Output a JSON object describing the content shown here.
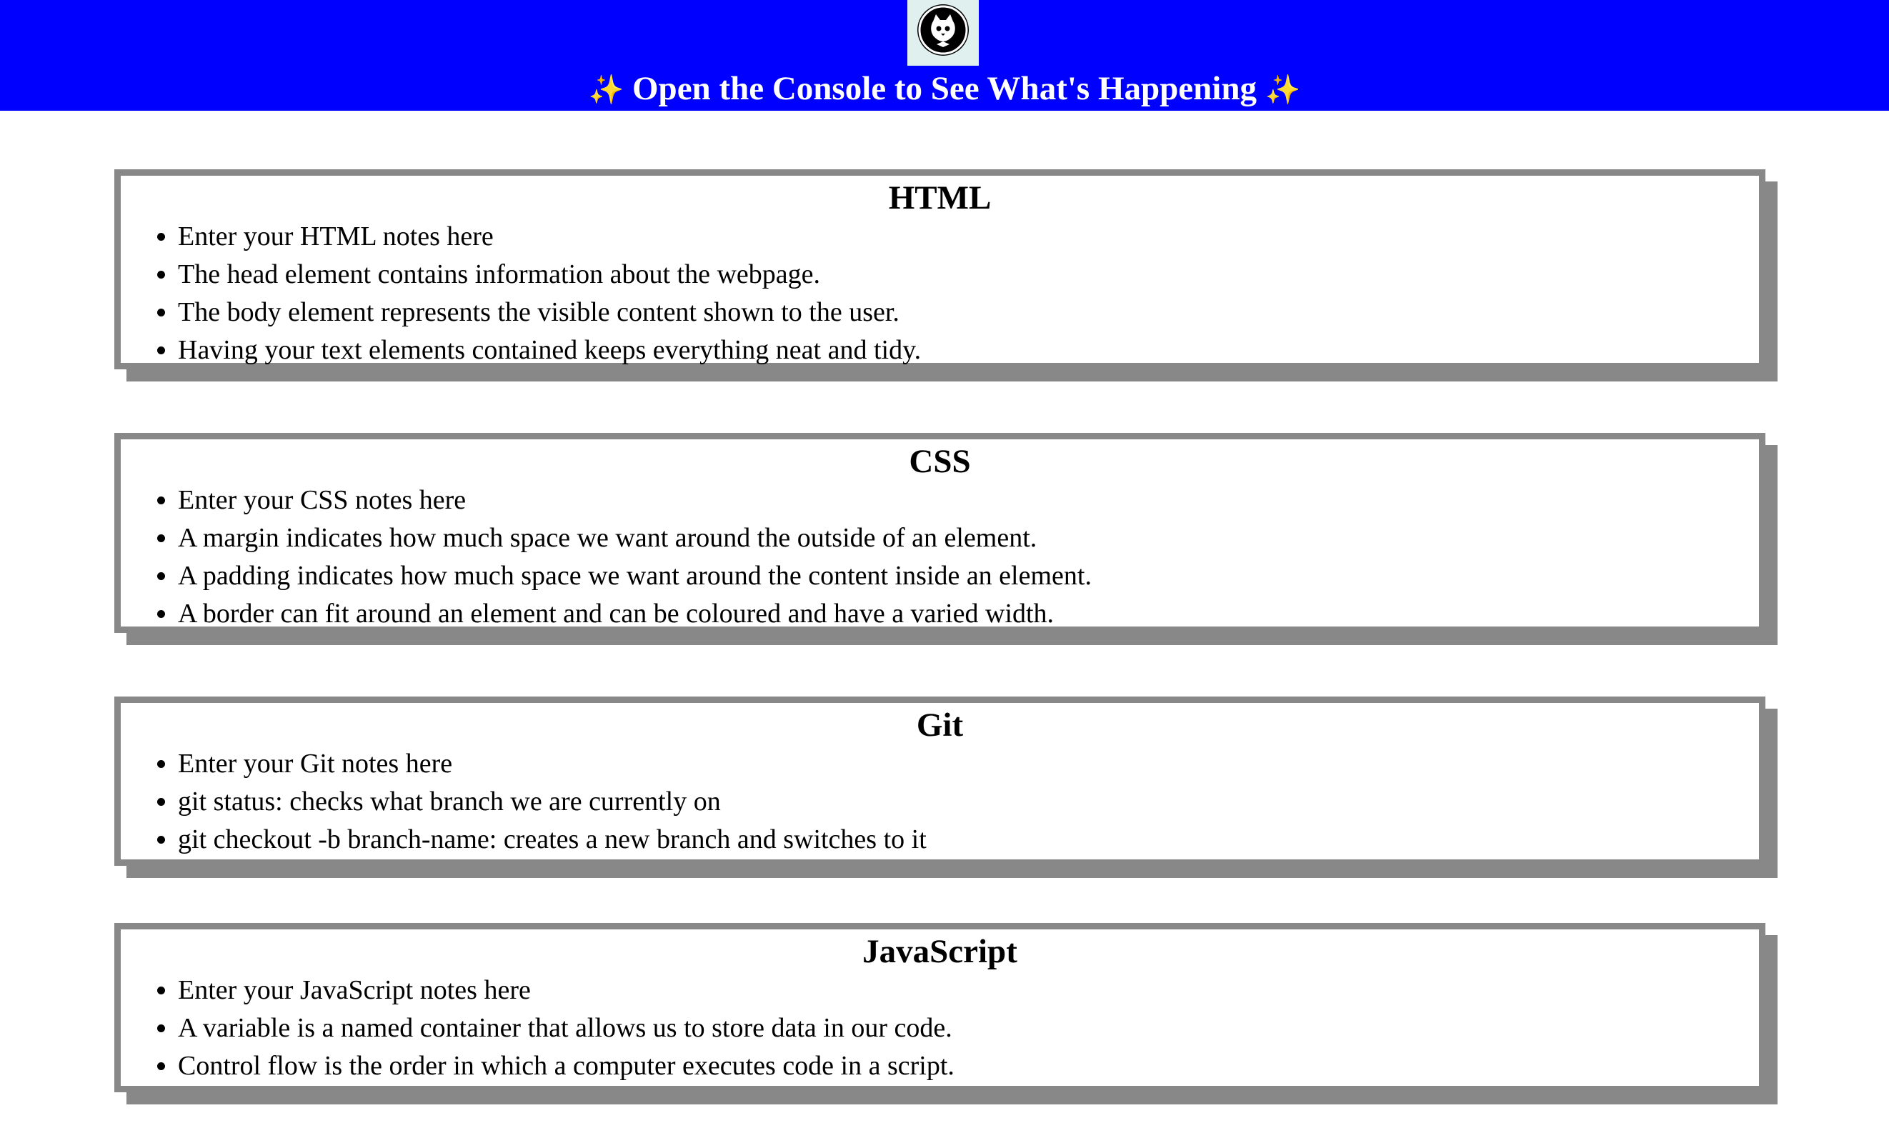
{
  "header": {
    "logo_icon": "cat-face-icon",
    "spark_left": "✨",
    "title": "Open the Console to See What's Happening",
    "spark_right": "✨",
    "background_color": "#0000ff"
  },
  "sections": [
    {
      "title": "HTML",
      "items": [
        "Enter your HTML notes here",
        "The head element contains information about the webpage.",
        "The body element represents the visible content shown to the user.",
        "Having your text elements contained keeps everything neat and tidy."
      ]
    },
    {
      "title": "CSS",
      "items": [
        "Enter your CSS notes here",
        "A margin indicates how much space we want around the outside of an element.",
        "A padding indicates how much space we want around the content inside an element.",
        "A border can fit around an element and can be coloured and have a varied width."
      ]
    },
    {
      "title": "Git",
      "items": [
        "Enter your Git notes here",
        "git status: checks what branch we are currently on",
        "git checkout -b branch-name: creates a new branch and switches to it"
      ]
    },
    {
      "title": "JavaScript",
      "items": [
        "Enter your JavaScript notes here",
        "A variable is a named container that allows us to store data in our code.",
        "Control flow is the order in which a computer executes code in a script."
      ]
    }
  ]
}
